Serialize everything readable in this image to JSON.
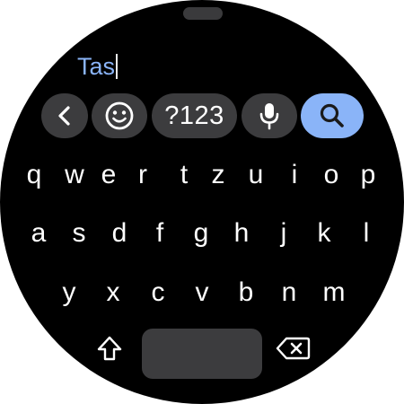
{
  "input": {
    "value": "Tas"
  },
  "toolbar": {
    "back_icon": "chevron-left-icon",
    "emoji_icon": "emoji-icon",
    "numbers_label": "?123",
    "mic_icon": "microphone-icon",
    "search_icon": "search-icon",
    "accent_color": "#8ab4f8"
  },
  "keyboard": {
    "row1": [
      "q",
      "w",
      "e",
      "r",
      "t",
      "z",
      "u",
      "i",
      "o",
      "p"
    ],
    "row2": [
      "a",
      "s",
      "d",
      "f",
      "g",
      "h",
      "j",
      "k",
      "l"
    ],
    "row3": [
      "y",
      "x",
      "c",
      "v",
      "b",
      "n",
      "m"
    ],
    "shift_icon": "shift-icon",
    "backspace_icon": "backspace-icon"
  }
}
